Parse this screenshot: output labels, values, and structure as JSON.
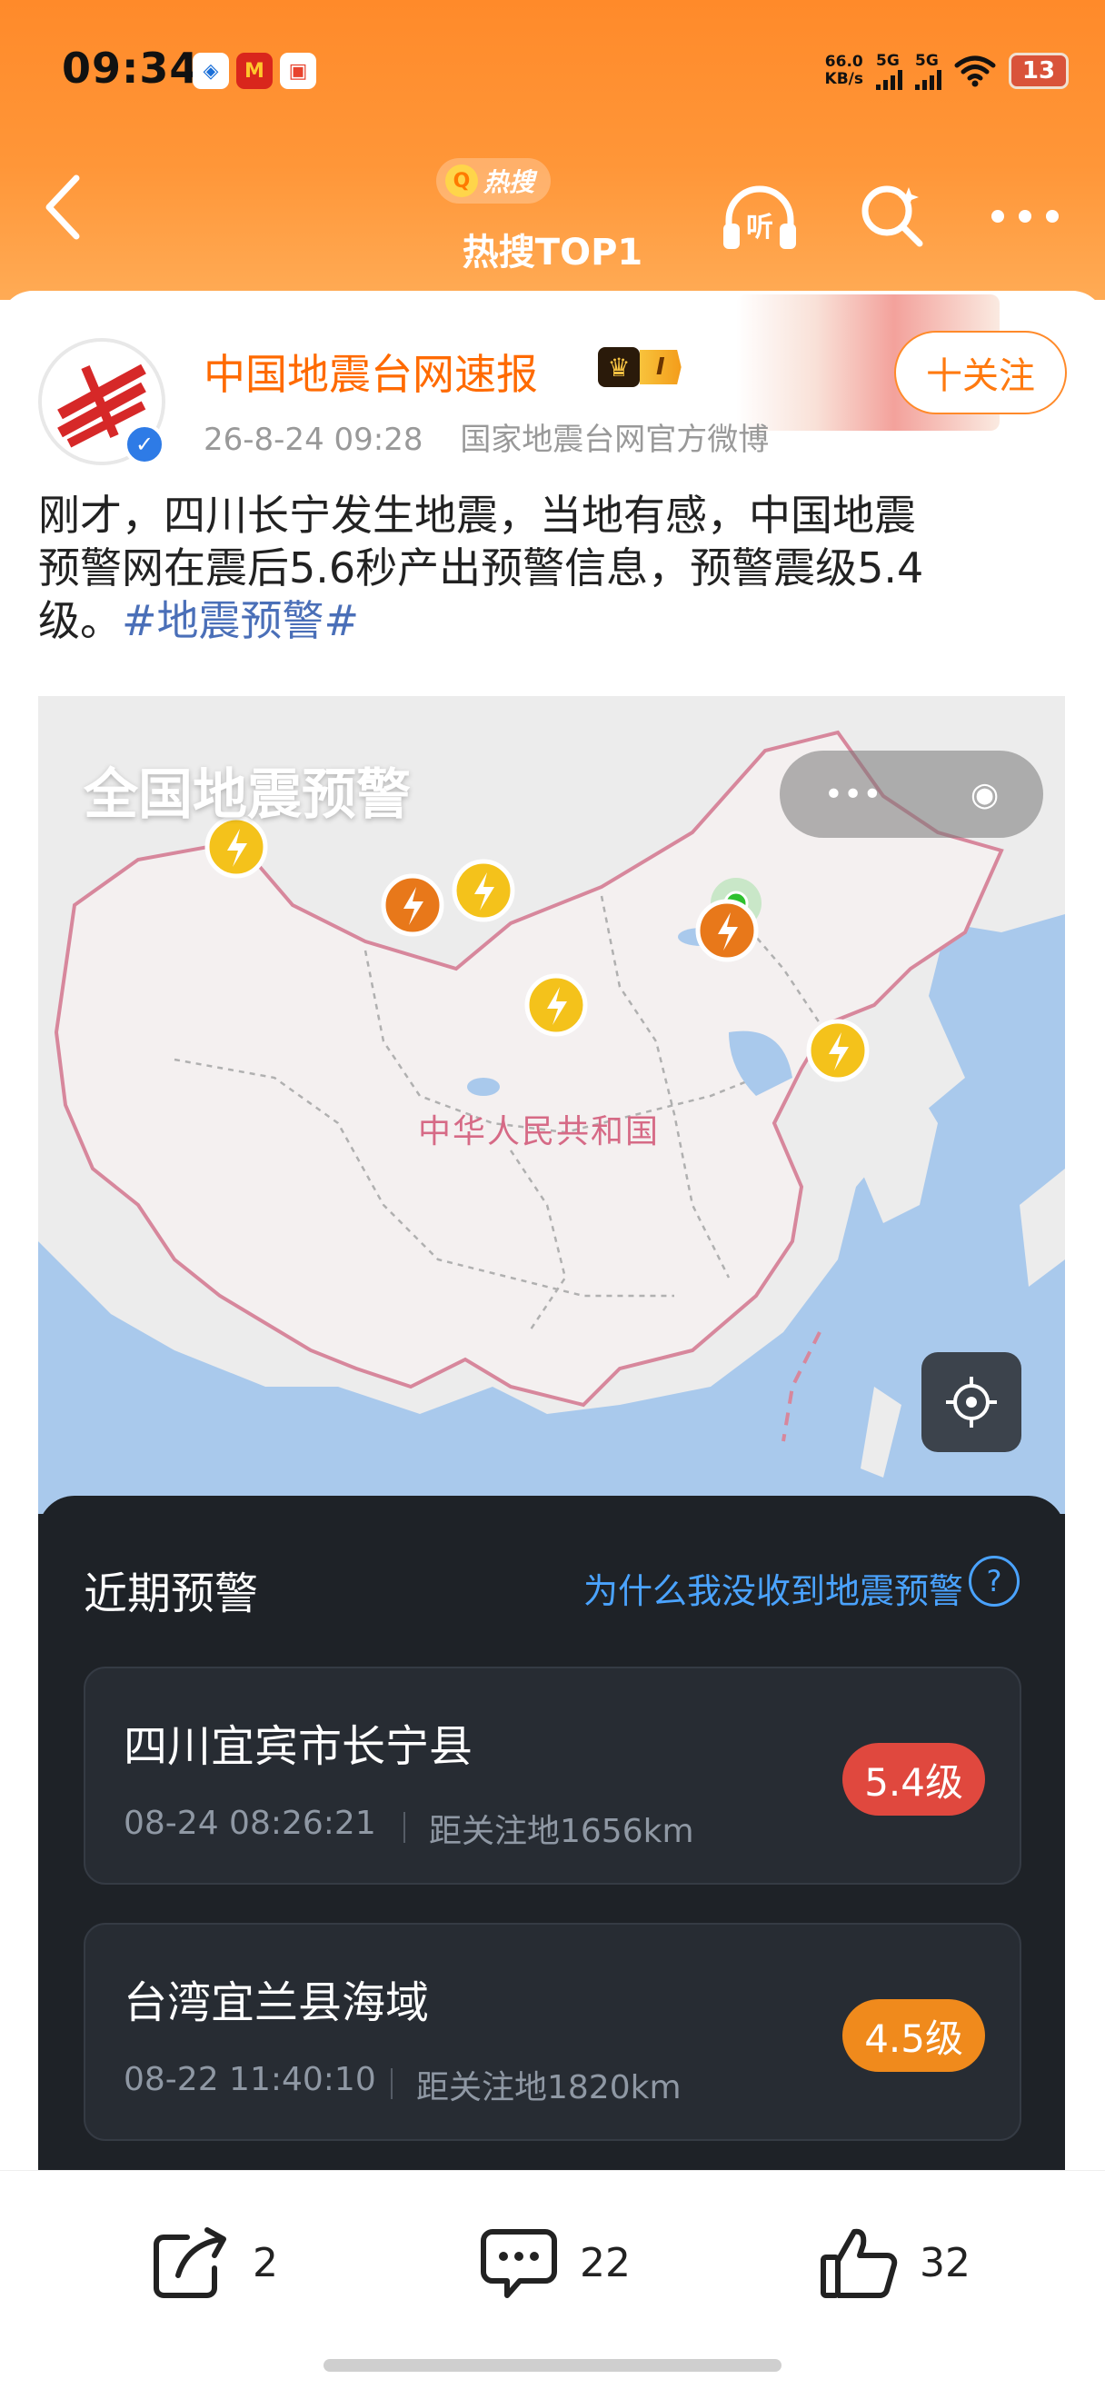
{
  "status_bar": {
    "time": "09:34",
    "netspeed_value": "66.0",
    "netspeed_unit": "KB/s",
    "signal1": "5G",
    "signal2": "5G",
    "battery": "13"
  },
  "header": {
    "badge": "热搜",
    "title": "热搜TOP1"
  },
  "post": {
    "author": "中国地震台网速报",
    "vip_level": "I",
    "follow_label": "十关注",
    "datetime": "26-8-24 09:28",
    "source": "国家地震台网官方微博",
    "text_line1": "刚才，四川长宁发生地震，当地有感，中国地震",
    "text_line2": "预警网在震后5.6秒产出预警信息，预警震级5.4",
    "text_line3_prefix": "级。",
    "hashtag": "#地震预警#"
  },
  "screenshot": {
    "map_title": "全国地震预警",
    "country_label": "中华人民共和国",
    "panel_title": "近期预警",
    "panel_link": "为什么我没收到地震预警",
    "alerts": [
      {
        "place": "四川宜宾市长宁县",
        "time": "08-24 08:26:21",
        "distance": "距关注地1656km",
        "magnitude": "5.4级",
        "color": "#e0483e"
      },
      {
        "place": "台湾宜兰县海域",
        "time": "08-22 11:40:10",
        "distance": "距关注地1820km",
        "magnitude": "4.5级",
        "color": "#f08a1c"
      }
    ]
  },
  "actions": {
    "share_count": "2",
    "comment_count": "22",
    "like_count": "32"
  }
}
